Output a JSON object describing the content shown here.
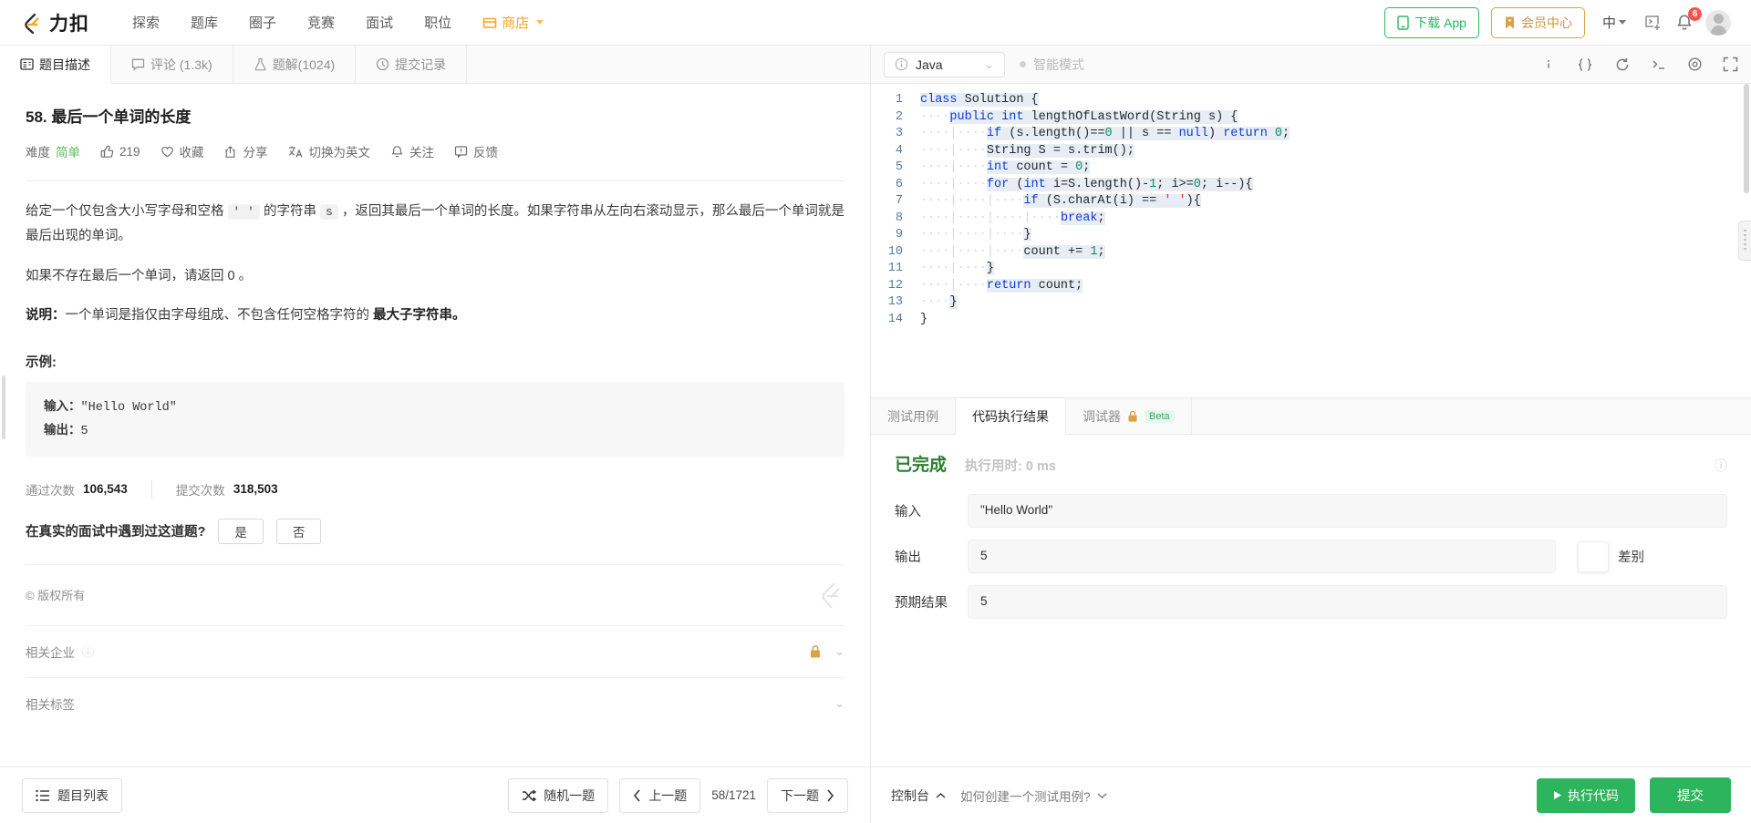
{
  "header": {
    "logo_text": "力扣",
    "nav": [
      {
        "label": "探索",
        "name": "nav-explore"
      },
      {
        "label": "题库",
        "name": "nav-problems"
      },
      {
        "label": "圈子",
        "name": "nav-circle"
      },
      {
        "label": "竞赛",
        "name": "nav-contest"
      },
      {
        "label": "面试",
        "name": "nav-interview"
      },
      {
        "label": "职位",
        "name": "nav-jobs"
      },
      {
        "label": "商店",
        "name": "nav-store"
      }
    ],
    "download_app": "下载 App",
    "member_center": "会员中心",
    "language": "中",
    "notification_count": "6"
  },
  "tabs": [
    {
      "label": "题目描述",
      "icon": "description-icon",
      "active": true
    },
    {
      "label": "评论 (1.3k)",
      "icon": "comment-icon",
      "active": false
    },
    {
      "label": "题解(1024)",
      "icon": "flask-icon",
      "active": false
    },
    {
      "label": "提交记录",
      "icon": "clock-icon",
      "active": false
    }
  ],
  "problem": {
    "title": "58. 最后一个单词的长度",
    "difficulty_label": "难度",
    "difficulty_value": "简单",
    "likes": "219",
    "favorite": "收藏",
    "share": "分享",
    "translate": "切换为英文",
    "follow": "关注",
    "feedback": "反馈",
    "para1_a": "给定一个仅包含大小写字母和空格 ",
    "para1_code1": "' '",
    "para1_b": " 的字符串 ",
    "para1_code2": "s",
    "para1_c": " ，返回其最后一个单词的长度。如果字符串从左向右滚动显示，那么最后一个单词就是最后出现的单词。",
    "para2": "如果不存在最后一个单词，请返回 0 。",
    "para3_bold": "说明：",
    "para3_a": "一个单词是指仅由字母组成、不包含任何空格字符的 ",
    "para3_b": "最大子字符串。",
    "example_title": "示例:",
    "example_input_label": "输入：",
    "example_input_value": "\"Hello World\"",
    "example_output_label": "输出：",
    "example_output_value": "5",
    "accepted_label": "通过次数",
    "accepted_value": "106,543",
    "submissions_label": "提交次数",
    "submissions_value": "318,503",
    "interview_question": "在真实的面试中遇到过这道题?",
    "yes": "是",
    "no": "否",
    "copyright": "© 版权所有",
    "companies": "相关企业",
    "tags": "相关标签"
  },
  "bottom_left": {
    "problem_list": "题目列表",
    "random": "随机一题",
    "prev": "上一题",
    "counter": "58/1721",
    "next": "下一题"
  },
  "editor": {
    "language": "Java",
    "smart_mode": "智能模式",
    "code_lines": [
      {
        "n": "1",
        "html": "<span class=\"hl\"><span class=\"kw\">class</span> Solution {</span>"
      },
      {
        "n": "2",
        "html": "<span class=\"ind\">····</span><span class=\"hl\"><span class=\"kw\">public</span> <span class=\"kw\">int</span> lengthOfLastWord(String s) {</span>"
      },
      {
        "n": "3",
        "html": "<span class=\"ind\">····|····</span><span class=\"hl\"><span class=\"kw\">if</span> (s.length()==<span class=\"num\">0</span> || s == <span class=\"kw\">null</span>) <span class=\"kw\">return</span> <span class=\"num\">0</span>;</span>"
      },
      {
        "n": "4",
        "html": "<span class=\"ind\">····|····</span><span class=\"hl\">String S = s.trim();</span>"
      },
      {
        "n": "5",
        "html": "<span class=\"ind\">····|····</span><span class=\"hl\"><span class=\"kw\">int</span> count = <span class=\"num\">0</span>;</span>"
      },
      {
        "n": "6",
        "html": "<span class=\"ind\">····|····</span><span class=\"hl\"><span class=\"kw\">for</span> (<span class=\"kw\">int</span> i=S.length()-<span class=\"num\">1</span>; i&gt;=<span class=\"num\">0</span>; i--){</span>"
      },
      {
        "n": "7",
        "html": "<span class=\"ind\">····|····|····</span><span class=\"hl\"><span class=\"kw\">if</span> (S.charAt(i) == <span class=\"str\">' '</span>){</span>"
      },
      {
        "n": "8",
        "html": "<span class=\"ind\">····|····|····|····</span><span class=\"hl\"><span class=\"kw\">break</span>;</span>"
      },
      {
        "n": "9",
        "html": "<span class=\"ind\">····|····|····</span><span class=\"hl\">}</span>"
      },
      {
        "n": "10",
        "html": "<span class=\"ind\">····|····|····</span><span class=\"hl\">count += <span class=\"num\">1</span>;</span>"
      },
      {
        "n": "11",
        "html": "<span class=\"ind\">····|····</span><span class=\"hl\">}</span>"
      },
      {
        "n": "12",
        "html": "<span class=\"ind\">····|····</span><span class=\"hl\"><span class=\"kw\">return</span> count;</span>"
      },
      {
        "n": "13",
        "html": "<span class=\"ind\">····</span><span class=\"hl\">}</span>"
      },
      {
        "n": "14",
        "html": "}"
      }
    ]
  },
  "console": {
    "tabs": [
      {
        "label": "测试用例",
        "active": false,
        "beta": false
      },
      {
        "label": "代码执行结果",
        "active": true,
        "beta": false
      },
      {
        "label": "调试器",
        "active": false,
        "beta": true,
        "beta_label": "Beta"
      }
    ],
    "status": "已完成",
    "runtime": "执行用时: 0 ms",
    "input_label": "输入",
    "input_value": "\"Hello World\"",
    "output_label": "输出",
    "output_value": "5",
    "diff_label": "差别",
    "expected_label": "预期结果",
    "expected_value": "5"
  },
  "bottom_right": {
    "console_toggle": "控制台",
    "howto": "如何创建一个测试用例?",
    "run": "执行代码",
    "submit": "提交"
  },
  "colors": {
    "brand_green": "#2db55d",
    "gold": "#d9a441",
    "easy_green": "#5cb85c",
    "success_green": "#2e7d32",
    "badge_red": "#f5544c"
  }
}
